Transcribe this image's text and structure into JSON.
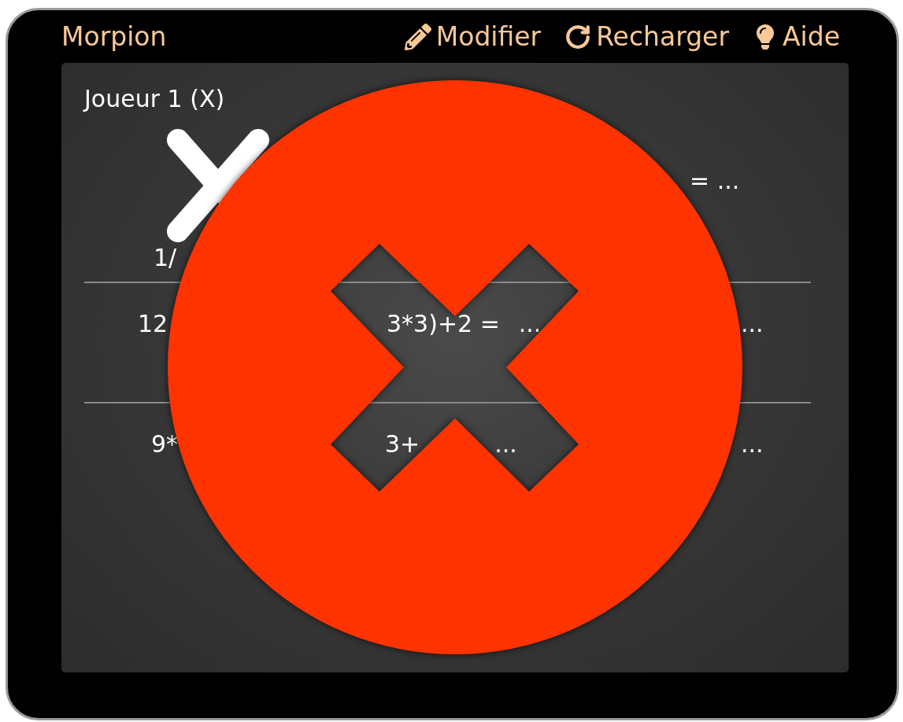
{
  "app": {
    "title": "Morpion"
  },
  "toolbar": [
    {
      "kind": "edit",
      "label": "Modifier"
    },
    {
      "kind": "reload",
      "label": "Recharger"
    },
    {
      "kind": "help",
      "label": "Aide"
    }
  ],
  "player": {
    "label": "Joueur 1 (X)"
  },
  "grid": {
    "rows": [
      {
        "column_1": [
          "1/"
        ],
        "column_3": [
          "= ..."
        ]
      },
      {
        "column_1": [
          "12"
        ],
        "column_2": [
          "3*3)+2 =",
          "..."
        ],
        "column_3": [
          "..."
        ]
      },
      {
        "column_1": [
          "9*"
        ],
        "column_2": [
          "3+",
          "..."
        ],
        "column_3": [
          "..."
        ]
      }
    ]
  },
  "overlay": {
    "kind": "cross"
  }
}
